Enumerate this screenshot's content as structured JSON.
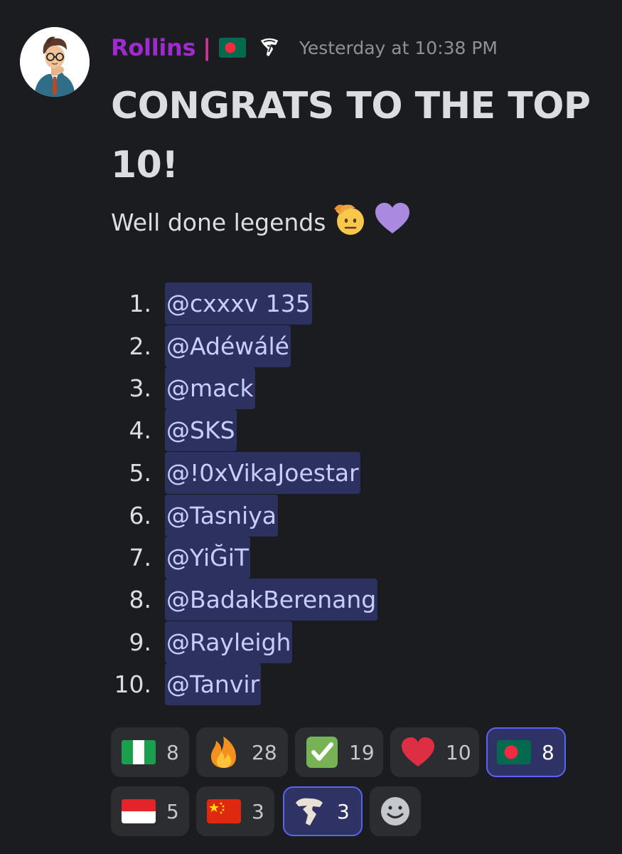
{
  "message": {
    "author": {
      "username": "Rollins",
      "separator": "|"
    },
    "timestamp": "Yesterday at 10:38 PM",
    "title": "CONGRATS TO THE TOP 10!",
    "subtitle": "Well done legends",
    "list": [
      {
        "number": "1.",
        "mention": "@cxxxv 135"
      },
      {
        "number": "2.",
        "mention": "@Adéwálé"
      },
      {
        "number": "3.",
        "mention": "@mack"
      },
      {
        "number": "4.",
        "mention": "@SKS"
      },
      {
        "number": "5.",
        "mention": "@!0xVikaJoestar"
      },
      {
        "number": "6.",
        "mention": "@Tasniya"
      },
      {
        "number": "7.",
        "mention": "@YiĞiT"
      },
      {
        "number": "8.",
        "mention": "@BadakBerenang"
      },
      {
        "number": "9.",
        "mention": "@Rayleigh"
      },
      {
        "number": "10.",
        "mention": "@Tanvir"
      }
    ],
    "reactions": [
      {
        "icon": "nigeria-flag-icon",
        "count": "8",
        "active": false
      },
      {
        "icon": "fire-icon",
        "count": "28",
        "active": false
      },
      {
        "icon": "check-mark-icon",
        "count": "19",
        "active": false
      },
      {
        "icon": "red-heart-icon",
        "count": "10",
        "active": false
      },
      {
        "icon": "bangladesh-flag-icon",
        "count": "8",
        "active": true
      },
      {
        "icon": "indonesia-flag-icon",
        "count": "5",
        "active": false
      },
      {
        "icon": "china-flag-icon",
        "count": "3",
        "active": false
      },
      {
        "icon": "custom-logo-icon",
        "count": "3",
        "active": true
      },
      {
        "icon": "add-reaction-icon",
        "count": "",
        "active": false
      }
    ]
  },
  "colors": {
    "background": "#1b1c20",
    "username": "#a02ad0",
    "mention_bg": "#3c3e75",
    "mention_text": "#c9cdfb",
    "reaction_bg": "#2b2d31",
    "reaction_active_border": "#5865f2"
  }
}
